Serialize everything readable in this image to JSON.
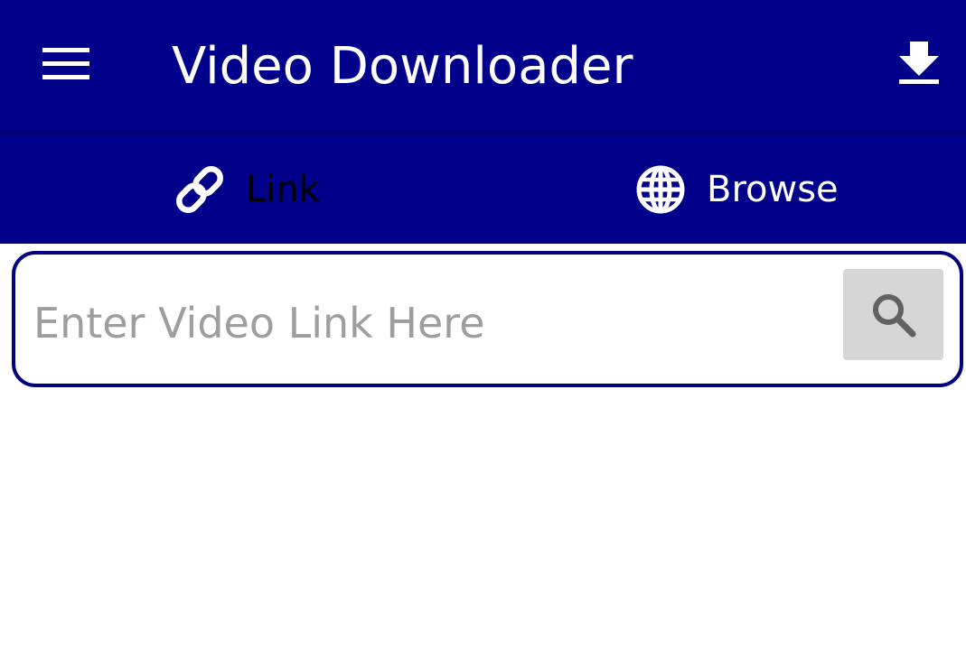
{
  "app_bar": {
    "title": "Video Downloader",
    "menu_icon": "hamburger-menu-icon",
    "download_icon": "download-icon",
    "background": "#00008b"
  },
  "tabs": [
    {
      "label": "Link",
      "icon": "link-icon",
      "selected": true,
      "label_color": "#000000"
    },
    {
      "label": "Browse",
      "icon": "globe-icon",
      "selected": false,
      "label_color": "#ffffff"
    }
  ],
  "search": {
    "value": "",
    "placeholder": "Enter Video Link Here",
    "button_icon": "search-icon",
    "border_color": "#000080",
    "button_background": "#d6d6d6"
  }
}
